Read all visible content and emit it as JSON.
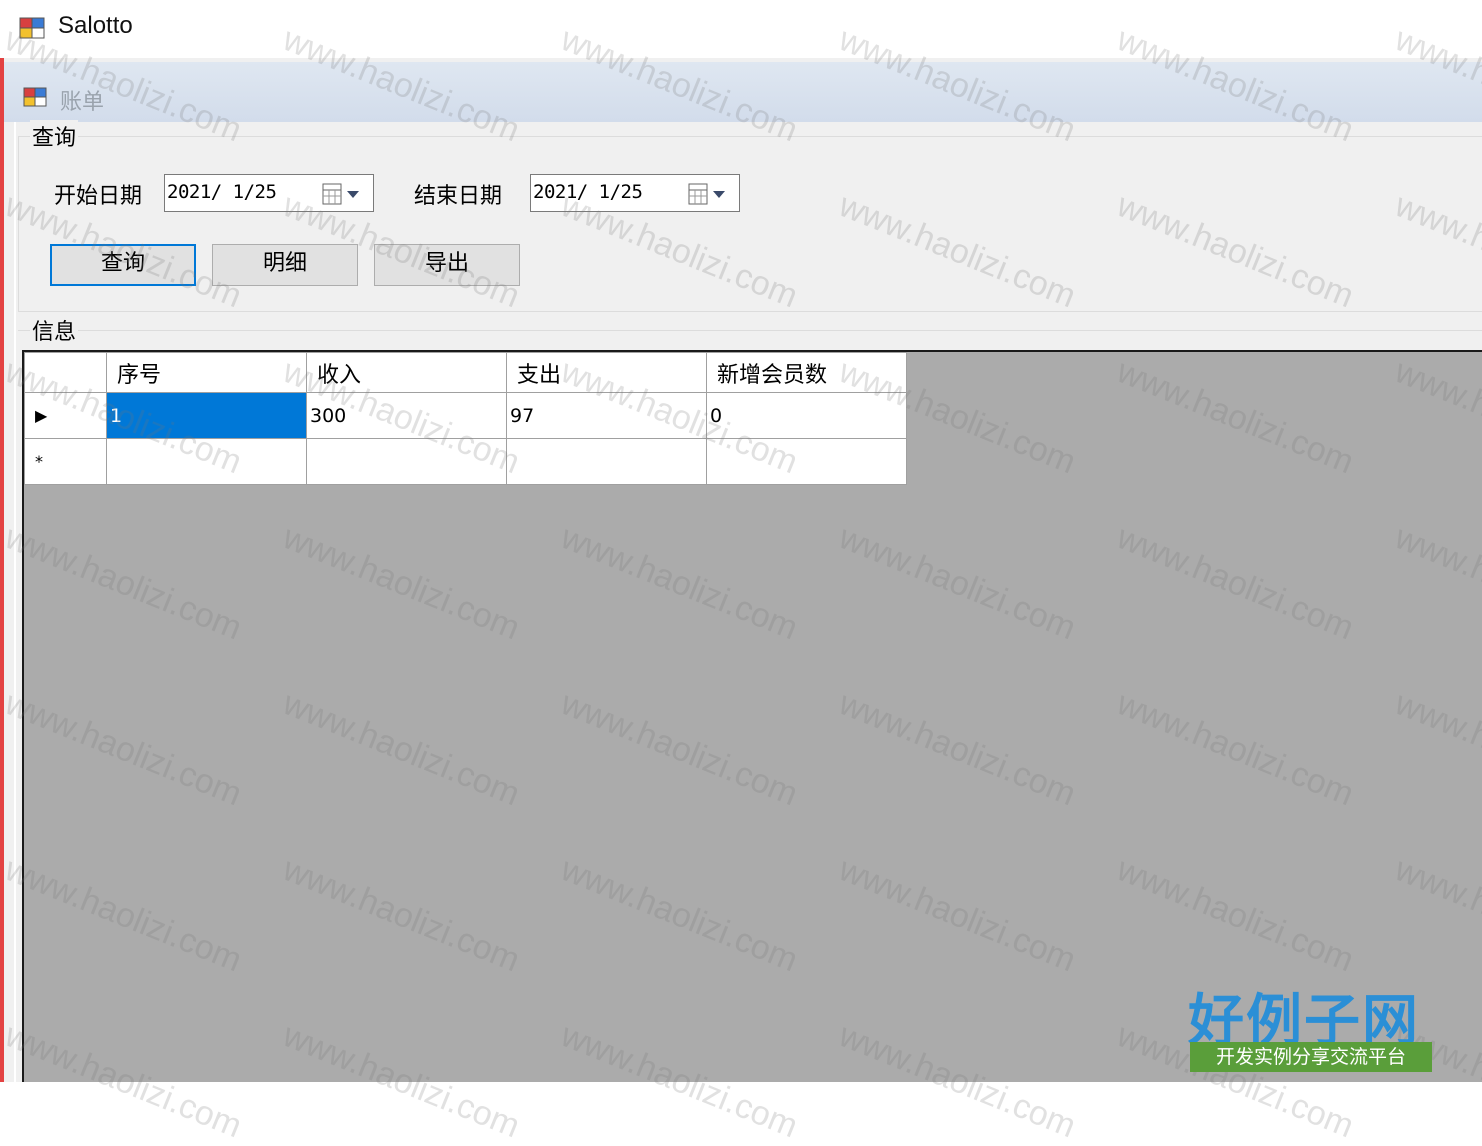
{
  "app": {
    "title": "Salotto",
    "icon": "app-window-icon"
  },
  "window": {
    "title": "账单",
    "icon": "form-window-icon"
  },
  "query_group": {
    "legend": "查询",
    "start_label": "开始日期",
    "start_value": "2021/ 1/25",
    "end_label": "结束日期",
    "end_value": "2021/ 1/25",
    "buttons": {
      "query": "查询",
      "detail": "明细",
      "export": "导出"
    }
  },
  "info_group": {
    "legend": "信息",
    "columns": [
      "序号",
      "收入",
      "支出",
      "新增会员数"
    ],
    "rows": [
      {
        "marker": "▶",
        "cells": [
          "1",
          "300",
          "97",
          "0"
        ]
      },
      {
        "marker": "*",
        "cells": [
          "",
          "",
          "",
          ""
        ]
      }
    ]
  },
  "watermark": {
    "text": "www.haolizi.com",
    "logo_title": "好例子网",
    "logo_subtitle": "开发实例分享交流平台"
  },
  "colors": {
    "selection": "#0078d7",
    "grid_background": "#ababab",
    "focus_border": "#0078d7"
  }
}
